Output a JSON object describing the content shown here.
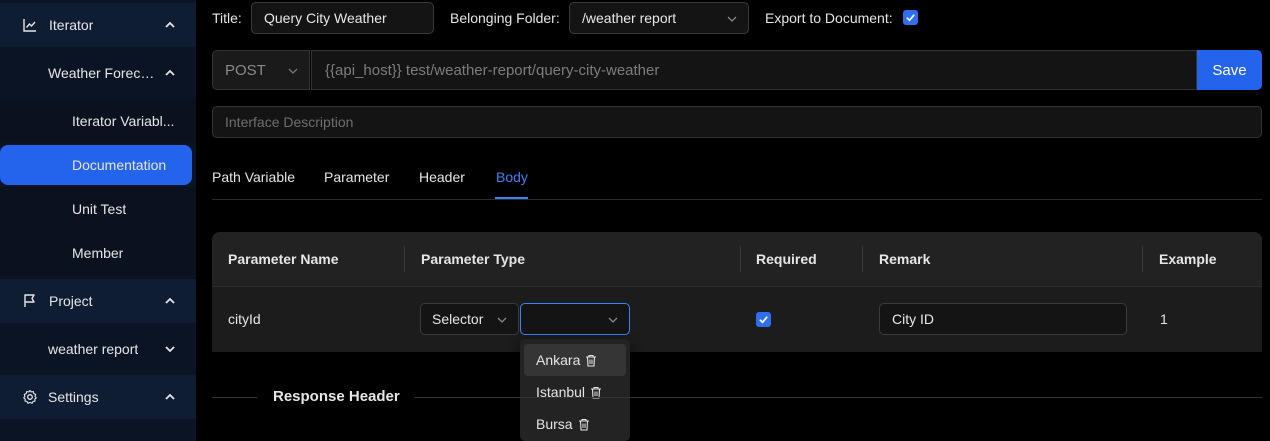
{
  "sidebar": {
    "items": [
      {
        "label": "Iterator",
        "icon": "chart-icon"
      },
      {
        "label": "Weather Foreca..."
      },
      {
        "label": "Iterator Variabl..."
      },
      {
        "label": "Documentation"
      },
      {
        "label": "Unit Test"
      },
      {
        "label": "Member"
      },
      {
        "label": "Project",
        "icon": "flag-icon"
      },
      {
        "label": "weather report"
      },
      {
        "label": "Settings",
        "icon": "gear-icon"
      }
    ]
  },
  "form": {
    "title_label": "Title:",
    "title_value": "Query City Weather",
    "folder_label": "Belonging Folder:",
    "folder_value": "/weather report",
    "export_label": "Export to Document:",
    "export_checked": true
  },
  "request": {
    "method": "POST",
    "url": "{{api_host}} test/weather-report/query-city-weather",
    "save_label": "Save",
    "description_placeholder": "Interface Description"
  },
  "tabs": [
    {
      "label": "Path Variable"
    },
    {
      "label": "Parameter"
    },
    {
      "label": "Header"
    },
    {
      "label": "Body",
      "active": true
    }
  ],
  "table": {
    "headers": [
      "Parameter Name",
      "Parameter Type",
      "Required",
      "Remark",
      "Example"
    ],
    "rows": [
      {
        "name": "cityId",
        "type_select": "Selector",
        "sub_select": "",
        "required": true,
        "remark": "City ID",
        "example": "1"
      }
    ]
  },
  "dropdown": {
    "options": [
      "Ankara",
      "Istanbul",
      "Bursa"
    ]
  },
  "response_header_title": "Response Header",
  "colors": {
    "accent": "#2463eb",
    "sidebar_bg": "#0b1424",
    "page_bg": "#000000"
  }
}
